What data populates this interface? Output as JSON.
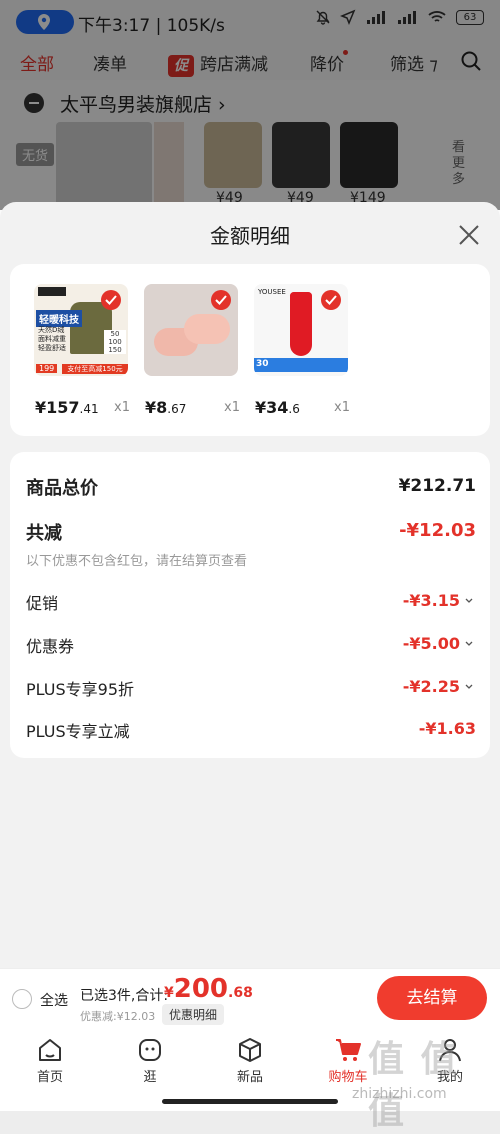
{
  "status_bar": {
    "time": "下午3:17 | 105K/s",
    "battery": "63"
  },
  "filter_tabs": {
    "all": "全部",
    "bundle": "凑单",
    "promo_badge": "促",
    "cross_store": "跨店满减",
    "price_drop": "降价",
    "filter": "筛选"
  },
  "background": {
    "shop_name": "太平鸟男装旗舰店 ›",
    "out_of_stock": "无货",
    "prices": [
      "¥49",
      "¥49",
      "¥149"
    ],
    "see_more": "看更多"
  },
  "sheet": {
    "title": "金额明细",
    "products": [
      {
        "price_int": "¥157",
        "price_dec": ".41",
        "qty": "x1",
        "tag": "轻暖科技",
        "sub": "天然D绒 面料减重 轻盈舒适",
        "badge": "199",
        "promo": "支付至高减150元"
      },
      {
        "price_int": "¥8",
        "price_dec": ".67",
        "qty": "x1"
      },
      {
        "price_int": "¥34",
        "price_dec": ".6",
        "qty": "x1",
        "brand": "YOUSEE",
        "badge": "30"
      }
    ],
    "totals": {
      "subtotal_label": "商品总价",
      "subtotal_value": "¥212.71",
      "reduction_label": "共减",
      "reduction_value": "-¥12.03",
      "note": "以下优惠不包含红包，请在结算页查看",
      "lines": [
        {
          "label": "促销",
          "value": "-¥3.15"
        },
        {
          "label": "优惠券",
          "value": "-¥5.00"
        },
        {
          "label": "PLUS专享95折",
          "value": "-¥2.25"
        },
        {
          "label": "PLUS专享立减",
          "value": "-¥1.63"
        }
      ]
    }
  },
  "checkout_bar": {
    "select_all": "全选",
    "summary": "已选3件,合计:",
    "total_symbol": "¥",
    "total_int": "200",
    "total_dec": ".68",
    "discount": "优惠减:¥12.03",
    "detail_chip": "优惠明细",
    "checkout_button": "去结算"
  },
  "bottom_nav": {
    "items": [
      {
        "label": "首页",
        "icon": "home-icon"
      },
      {
        "label": "逛",
        "icon": "browse-icon"
      },
      {
        "label": "新品",
        "icon": "box-icon"
      },
      {
        "label": "购物车",
        "icon": "cart-icon"
      },
      {
        "label": "我的",
        "icon": "profile-icon"
      }
    ]
  },
  "watermark": {
    "text": "值 值 值",
    "url": "zhizhizhi.com"
  },
  "colors": {
    "accent": "#e3322a",
    "checkout": "#f03c2e",
    "location": "#1f6bf2"
  }
}
